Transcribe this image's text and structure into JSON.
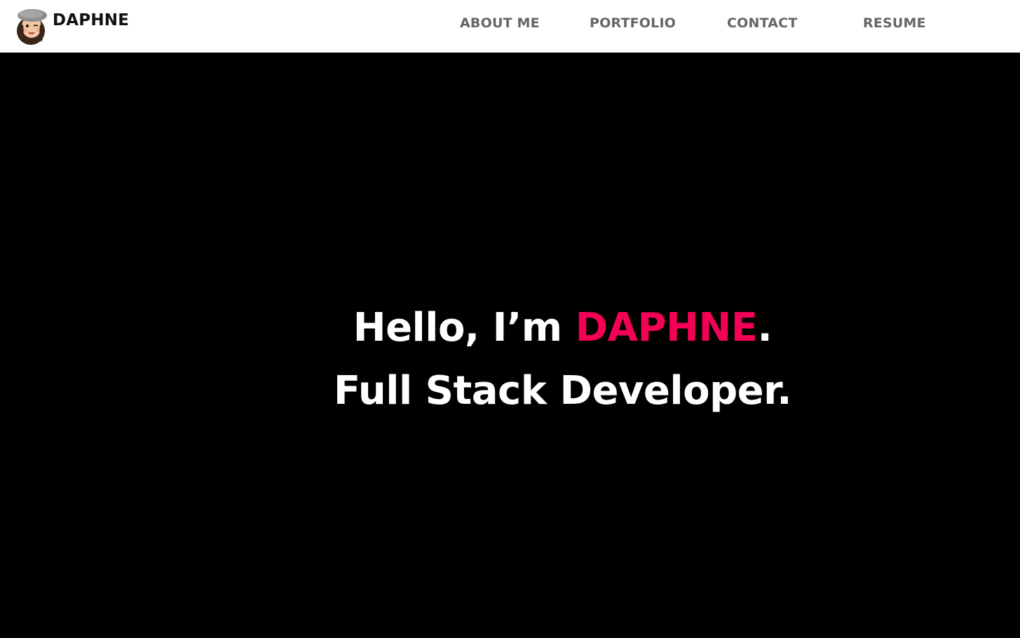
{
  "header": {
    "brand_name": "DAPHNE",
    "avatar_icon": "memoji-avatar-icon",
    "nav": [
      {
        "label": "ABOUT ME"
      },
      {
        "label": "PORTFOLIO"
      },
      {
        "label": "CONTACT"
      },
      {
        "label": "RESUME"
      }
    ]
  },
  "hero": {
    "greeting_prefix": "Hello, I’m ",
    "name": "DAPHNE",
    "greeting_suffix": ".",
    "role": "Full Stack Developer."
  },
  "colors": {
    "accent": "#f50057",
    "background": "#000000",
    "nav_bg": "#ffffff",
    "nav_text": "#666666"
  }
}
